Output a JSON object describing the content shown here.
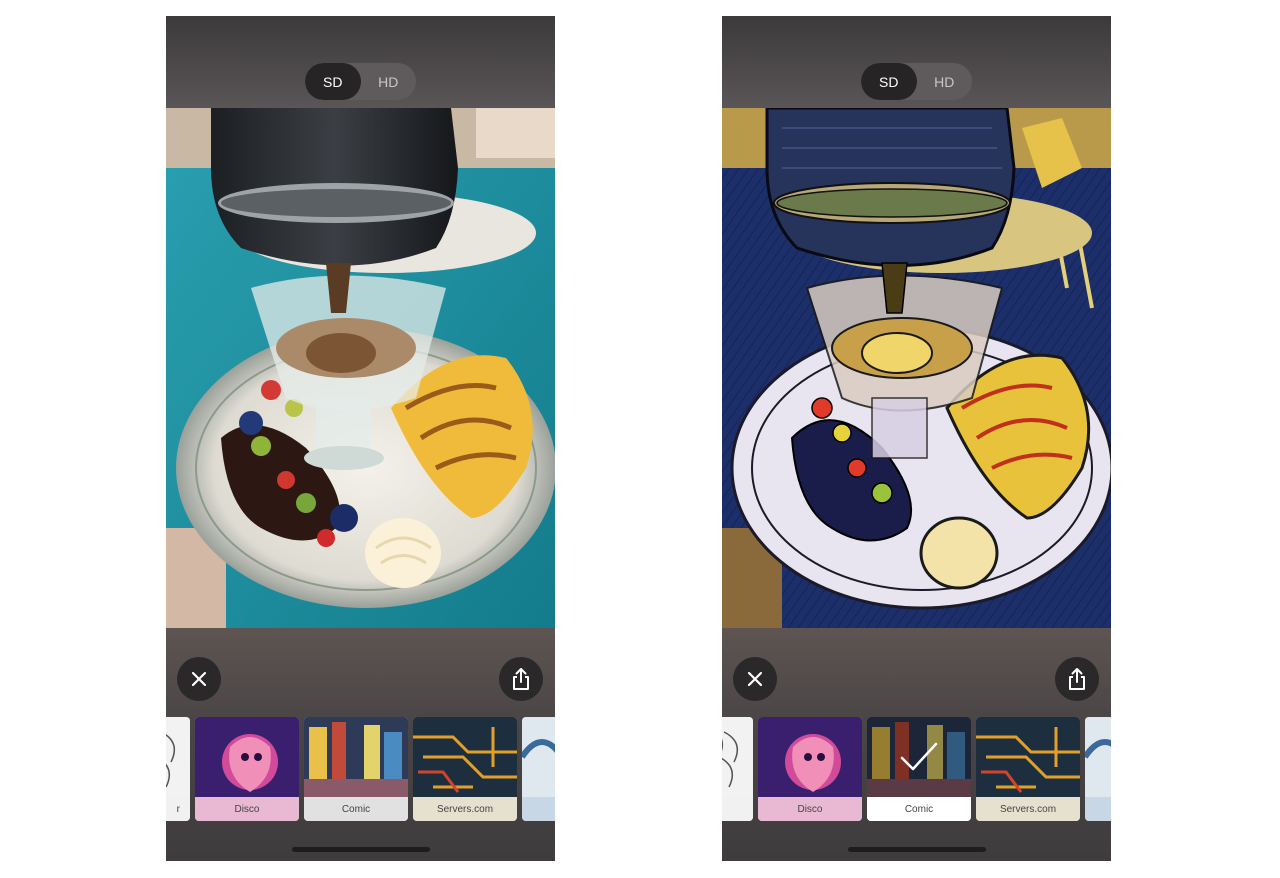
{
  "screens": [
    {
      "id": "original",
      "quality": {
        "sd_label": "SD",
        "hd_label": "HD",
        "selected": "SD"
      },
      "filters": [
        {
          "label": "r"
        },
        {
          "label": "Disco"
        },
        {
          "label": "Comic"
        },
        {
          "label": "Servers.com"
        },
        {
          "label": ""
        }
      ],
      "selected_filter": null
    },
    {
      "id": "filtered",
      "quality": {
        "sd_label": "SD",
        "hd_label": "HD",
        "selected": "SD"
      },
      "filters": [
        {
          "label": "r"
        },
        {
          "label": "Disco"
        },
        {
          "label": "Comic"
        },
        {
          "label": "Servers.com"
        },
        {
          "label": ""
        }
      ],
      "selected_filter": "Comic"
    }
  ],
  "icons": {
    "close": "close-icon",
    "share": "share-icon",
    "check": "checkmark-icon"
  },
  "colors": {
    "segment_selected_bg": "#262425",
    "segment_bg": "#5f5b5c",
    "button_bg": "#2a2829",
    "table_teal": "#1f8a9c",
    "comic_blue": "#1c2f6b",
    "disco_purple": "#3a1f6e"
  }
}
